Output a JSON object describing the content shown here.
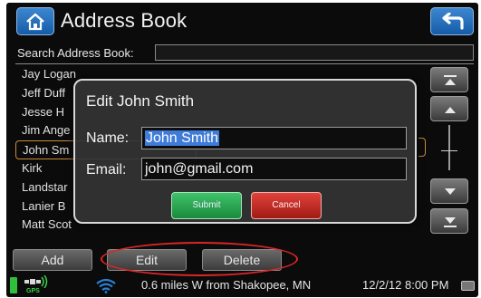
{
  "header": {
    "title": "Address Book",
    "home_icon": "home-icon",
    "back_icon": "back-arrow-icon"
  },
  "search": {
    "label": "Search Address Book:",
    "value": ""
  },
  "contacts": [
    {
      "name": "Jay Logan"
    },
    {
      "name": "Jeff Duff"
    },
    {
      "name": "Jesse H"
    },
    {
      "name": "Jim Ange"
    },
    {
      "name": "John Sm"
    },
    {
      "name": "Kirk"
    },
    {
      "name": "Landstar"
    },
    {
      "name": "Lanier B"
    },
    {
      "name": "Matt Scot"
    }
  ],
  "dialog": {
    "title": "Edit John Smith",
    "name_label": "Name:",
    "name_value": "John Smith",
    "email_label": "Email:",
    "email_value": "john@gmail.com",
    "submit_label": "Submit",
    "cancel_label": "Cancel"
  },
  "actions": {
    "add_label": "Add",
    "edit_label": "Edit",
    "delete_label": "Delete"
  },
  "status": {
    "gps_label": "GPS",
    "location": "0.6 miles W from Shakopee, MN",
    "datetime": "12/2/12 8:00 PM"
  },
  "colors": {
    "accent_blue": "#2a6fbe",
    "submit_green": "#27a34f",
    "cancel_red": "#c42a22",
    "annotation_red": "#d92626"
  }
}
